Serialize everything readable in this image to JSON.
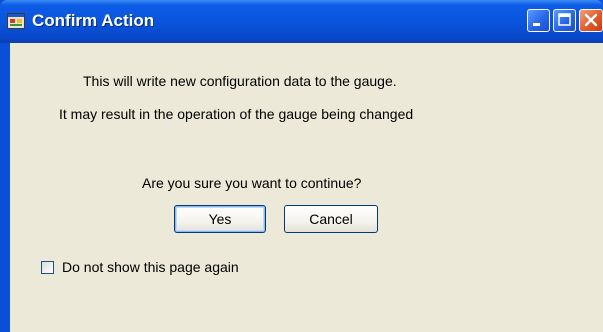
{
  "window": {
    "title": "Confirm Action",
    "controls": {
      "minimize": "minimize",
      "maximize": "maximize",
      "close": "close"
    }
  },
  "dialog": {
    "message_line1": "This will write new configuration data to the gauge.",
    "message_line2": "It may result in the operation of the gauge being changed",
    "question": "Are you sure you want to continue?",
    "yes_label": "Yes",
    "cancel_label": "Cancel",
    "checkbox_label": "Do not show this page again",
    "checkbox_checked": false
  },
  "colors": {
    "titlebar": "#0a55de",
    "client_bg": "#ece9d8",
    "button_border": "#003c74",
    "close_button": "#e35a2a"
  },
  "icons": {
    "app": "application-icon",
    "minimize": "minimize-icon",
    "maximize": "maximize-icon",
    "close": "close-icon"
  }
}
